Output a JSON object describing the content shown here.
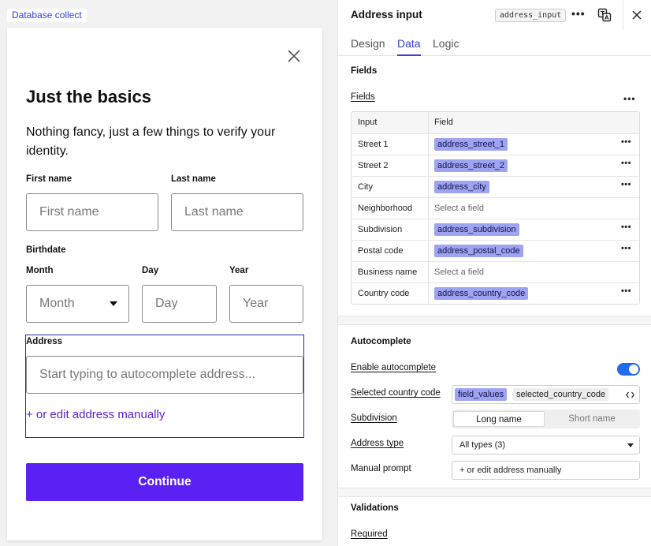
{
  "canvas": {
    "tag": "Database collect",
    "title": "Just the basics",
    "description": "Nothing fancy, just a few things to verify your identity.",
    "first_name": {
      "label": "First name",
      "placeholder": "First name"
    },
    "last_name": {
      "label": "Last name",
      "placeholder": "Last name"
    },
    "birthdate": {
      "label": "Birthdate",
      "month": {
        "label": "Month",
        "placeholder": "Month"
      },
      "day": {
        "label": "Day",
        "placeholder": "Day"
      },
      "year": {
        "label": "Year",
        "placeholder": "Year"
      }
    },
    "address": {
      "label": "Address",
      "placeholder": "Start typing to autocomplete address...",
      "manual_link": "+ or edit address manually"
    },
    "continue_label": "Continue"
  },
  "panel": {
    "title": "Address input",
    "code": "address_input",
    "tabs": [
      {
        "label": "Design",
        "active": false
      },
      {
        "label": "Data",
        "active": true
      },
      {
        "label": "Logic",
        "active": false
      }
    ],
    "fields_section": {
      "title": "Fields",
      "fields_label": "Fields",
      "columns": [
        "Input",
        "Field"
      ],
      "rows": [
        {
          "input": "Street 1",
          "field": "address_street_1",
          "mapped": true
        },
        {
          "input": "Street 2",
          "field": "address_street_2",
          "mapped": true
        },
        {
          "input": "City",
          "field": "address_city",
          "mapped": true
        },
        {
          "input": "Neighborhood",
          "field": "Select a field",
          "mapped": false
        },
        {
          "input": "Subdivision",
          "field": "address_subdivision",
          "mapped": true
        },
        {
          "input": "Postal code",
          "field": "address_postal_code",
          "mapped": true
        },
        {
          "input": "Business name",
          "field": "Select a field",
          "mapped": false
        },
        {
          "input": "Country code",
          "field": "address_country_code",
          "mapped": true
        }
      ]
    },
    "autocomplete": {
      "title": "Autocomplete",
      "enable_label": "Enable autocomplete",
      "enabled": true,
      "country_label": "Selected country code",
      "country_source": "field_values",
      "country_field": "selected_country_code",
      "subdivision_label": "Subdivision",
      "subdivision_options": [
        "Long name",
        "Short name"
      ],
      "subdivision_selected": "Long name",
      "address_type_label": "Address type",
      "address_type_value": "All types (3)",
      "manual_prompt_label": "Manual prompt",
      "manual_prompt_value": "+ or edit address manually"
    },
    "validations": {
      "title": "Validations",
      "required_label": "Required"
    }
  },
  "colors": {
    "primary": "#5b21f4",
    "link": "#5b21d6",
    "tab_active": "#3b3fd8",
    "chip": "#9ea3f2",
    "toggle_on": "#1f6cf0"
  }
}
